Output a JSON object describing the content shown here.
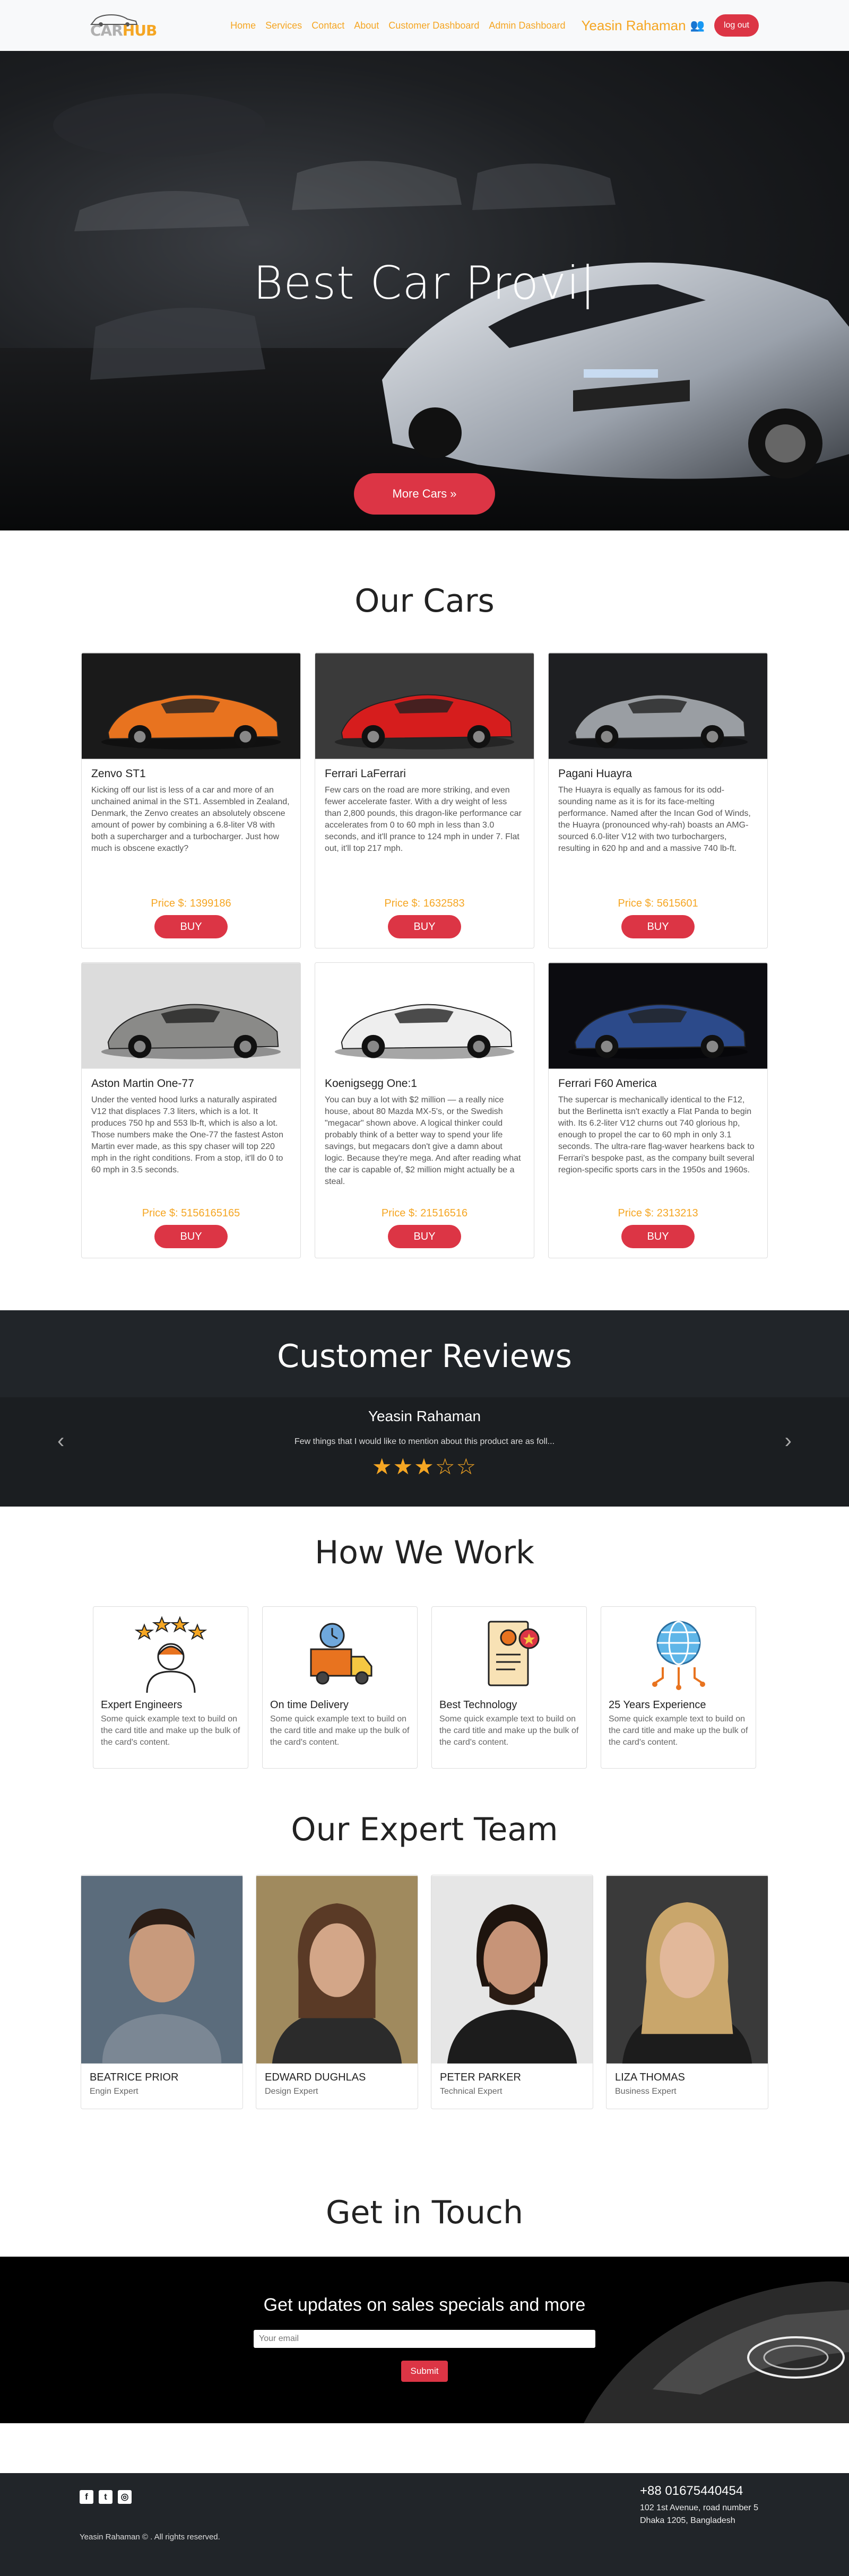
{
  "nav": {
    "logo_car": "CAR",
    "logo_hub": "HUB",
    "links": [
      "Home",
      "Services",
      "Contact",
      "About",
      "Customer Dashboard",
      "Admin Dashboard"
    ],
    "user": "Yeasin Rahaman",
    "logout": "log out"
  },
  "hero": {
    "title": "Best Car Provi|",
    "button": "More Cars »"
  },
  "cars": {
    "title": "Our Cars",
    "buy_label": "BUY",
    "items": [
      {
        "name": "Zenvo ST1",
        "desc": "Kicking off our list is less of a car and more of an unchained animal in the ST1. Assembled in Zealand, Denmark, the Zenvo creates an absolutely obscene amount of power by combining a 6.8-liter V8 with both a supercharger and a turbocharger. Just how much is obscene exactly?",
        "price": "Price $: 1399186",
        "color": "#e8731f"
      },
      {
        "name": "Ferrari LaFerrari",
        "desc": "Few cars on the road are more striking, and even fewer accelerate faster. With a dry weight of less than 2,800 pounds, this dragon-like performance car accelerates from 0 to 60 mph in less than 3.0 seconds, and it'll prance to 124 mph in under 7. Flat out, it'll top 217 mph.",
        "price": "Price $: 1632583",
        "color": "#d61d1d"
      },
      {
        "name": "Pagani Huayra",
        "desc": "The Huayra is equally as famous for its odd-sounding name as it is for its face-melting performance. Named after the Incan God of Winds, the Huayra (pronounced why-rah) boasts an AMG-sourced 6.0-liter V12 with two turbochargers, resulting in 620 hp and and a massive 740 lb-ft.",
        "price": "Price $: 5615601",
        "color": "#9a9ea3"
      },
      {
        "name": "Aston Martin One-77",
        "desc": "Under the vented hood lurks a naturally aspirated V12 that displaces 7.3 liters, which is a lot. It produces 750 hp and 553 lb-ft, which is also a lot. Those numbers make the One-77 the fastest Aston Martin ever made, as this spy chaser will top 220 mph in the right conditions. From a stop, it'll do 0 to 60 mph in 3.5 seconds.",
        "price": "Price $: 5156165165",
        "color": "#8a8a88"
      },
      {
        "name": "Koenigsegg One:1",
        "desc": "You can buy a lot with $2 million — a really nice house, about 80 Mazda MX-5's, or the Swedish \"megacar\" shown above. A logical thinker could probably think of a better way to spend your life savings, but megacars don't give a damn about logic. Because they're mega. And after reading what the car is capable of, $2 million might actually be a steal.",
        "price": "Price $: 21516516",
        "color": "#eeeeee"
      },
      {
        "name": "Ferrari F60 America",
        "desc": "The supercar is mechanically identical to the F12, but the Berlinetta isn't exactly a Flat Panda to begin with. Its 6.2-liter V12 churns out 740 glorious hp, enough to propel the car to 60 mph in only 3.1 seconds. The ultra-rare flag-waver hearkens back to Ferrari's bespoke past, as the company built several region-specific sports cars in the 1950s and 1960s.",
        "price": "Price $: 2313213",
        "color": "#2c4a8a"
      }
    ]
  },
  "reviews": {
    "title": "Customer Reviews",
    "name": "Yeasin Rahaman",
    "text": "Few things that I would like to mention about this product are as foll...",
    "rating": 3,
    "stars_display": "★★★☆☆"
  },
  "work": {
    "title": "How We Work",
    "items": [
      {
        "title": "Expert Engineers",
        "text": "Some quick example text to build on the card title and make up the bulk of the card's content."
      },
      {
        "title": "On time Delivery",
        "text": "Some quick example text to build on the card title and make up the bulk of the card's content."
      },
      {
        "title": "Best Technology",
        "text": "Some quick example text to build on the card title and make up the bulk of the card's content."
      },
      {
        "title": "25 Years Experience",
        "text": "Some quick example text to build on the card title and make up the bulk of the card's content."
      }
    ]
  },
  "team": {
    "title": "Our Expert Team",
    "members": [
      {
        "name": "BEATRICE PRIOR",
        "role": "Engin Expert"
      },
      {
        "name": "EDWARD DUGHLAS",
        "role": "Design Expert"
      },
      {
        "name": "PETER PARKER",
        "role": "Technical Expert"
      },
      {
        "name": "LIZA THOMAS",
        "role": "Business Expert"
      }
    ]
  },
  "contact": {
    "title": "Get in Touch",
    "heading": "Get updates on sales specials and more",
    "placeholder": "Your email",
    "submit": "Submit"
  },
  "footer": {
    "copyright": "Yeasin Rahaman © . All rights reserved.",
    "phone": "+88 01675440454",
    "address1": "102 1st Avenue, road number 5",
    "address2": "Dhaka 1205, Bangladesh",
    "social": [
      "f",
      "t",
      "◎"
    ]
  }
}
